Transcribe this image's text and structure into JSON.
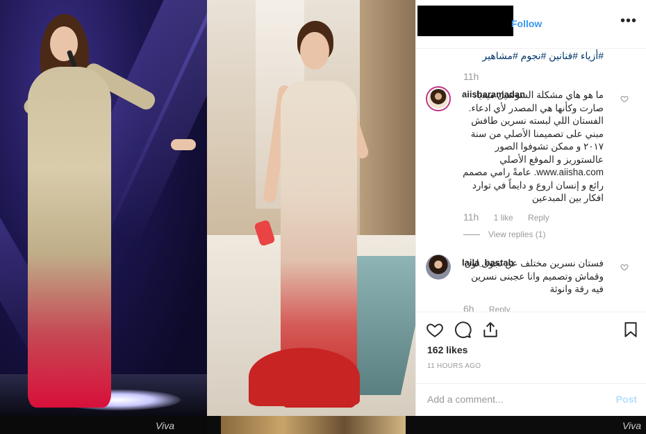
{
  "header": {
    "follow_label": "Follow",
    "more_label": "•••"
  },
  "caption": {
    "hashtags": "#أزياء #فنانين #نجوم #مشاهير",
    "time": "11h"
  },
  "comments": [
    {
      "username": "aiisharamadan",
      "text": "ما هو هاي مشكلة السوشيل ميديا، صارت وكأنها هي المصدر لأي ادعاء. الفستان اللي لبسته نسرين طافش مبني على تصميمنا الأصلي من سنة ٢٠١٧ و ممكن تشوفوا الصور عالستوريز و الموقع الأصلي www.aiisha.com. عامةً رامي مصمم رائع و إنسان اروع و دايماً في توارد افكار بين المبدعين",
      "time": "11h",
      "likes": "1 like",
      "reply": "Reply",
      "view_replies": "View replies (1)"
    },
    {
      "username": "laila_bastah",
      "text": "فستان نسرين مختلف عن نجوى لون وقماش وتصميم وانا عجبنى نسرين فيه رقة وانوثة",
      "time": "6h",
      "reply": "Reply"
    }
  ],
  "actions": {
    "icons": [
      "heart-icon",
      "comment-icon",
      "share-icon",
      "bookmark-icon"
    ],
    "likes": "162 likes",
    "time_ago": "11 HOURS AGO"
  },
  "add_comment": {
    "placeholder": "Add a comment...",
    "post_label": "Post"
  },
  "strip": {
    "watermark": "Viva"
  },
  "colors": {
    "link": "#3897f0",
    "hashtag": "#003569",
    "muted": "#999999",
    "post_disabled": "#b2dffc"
  }
}
